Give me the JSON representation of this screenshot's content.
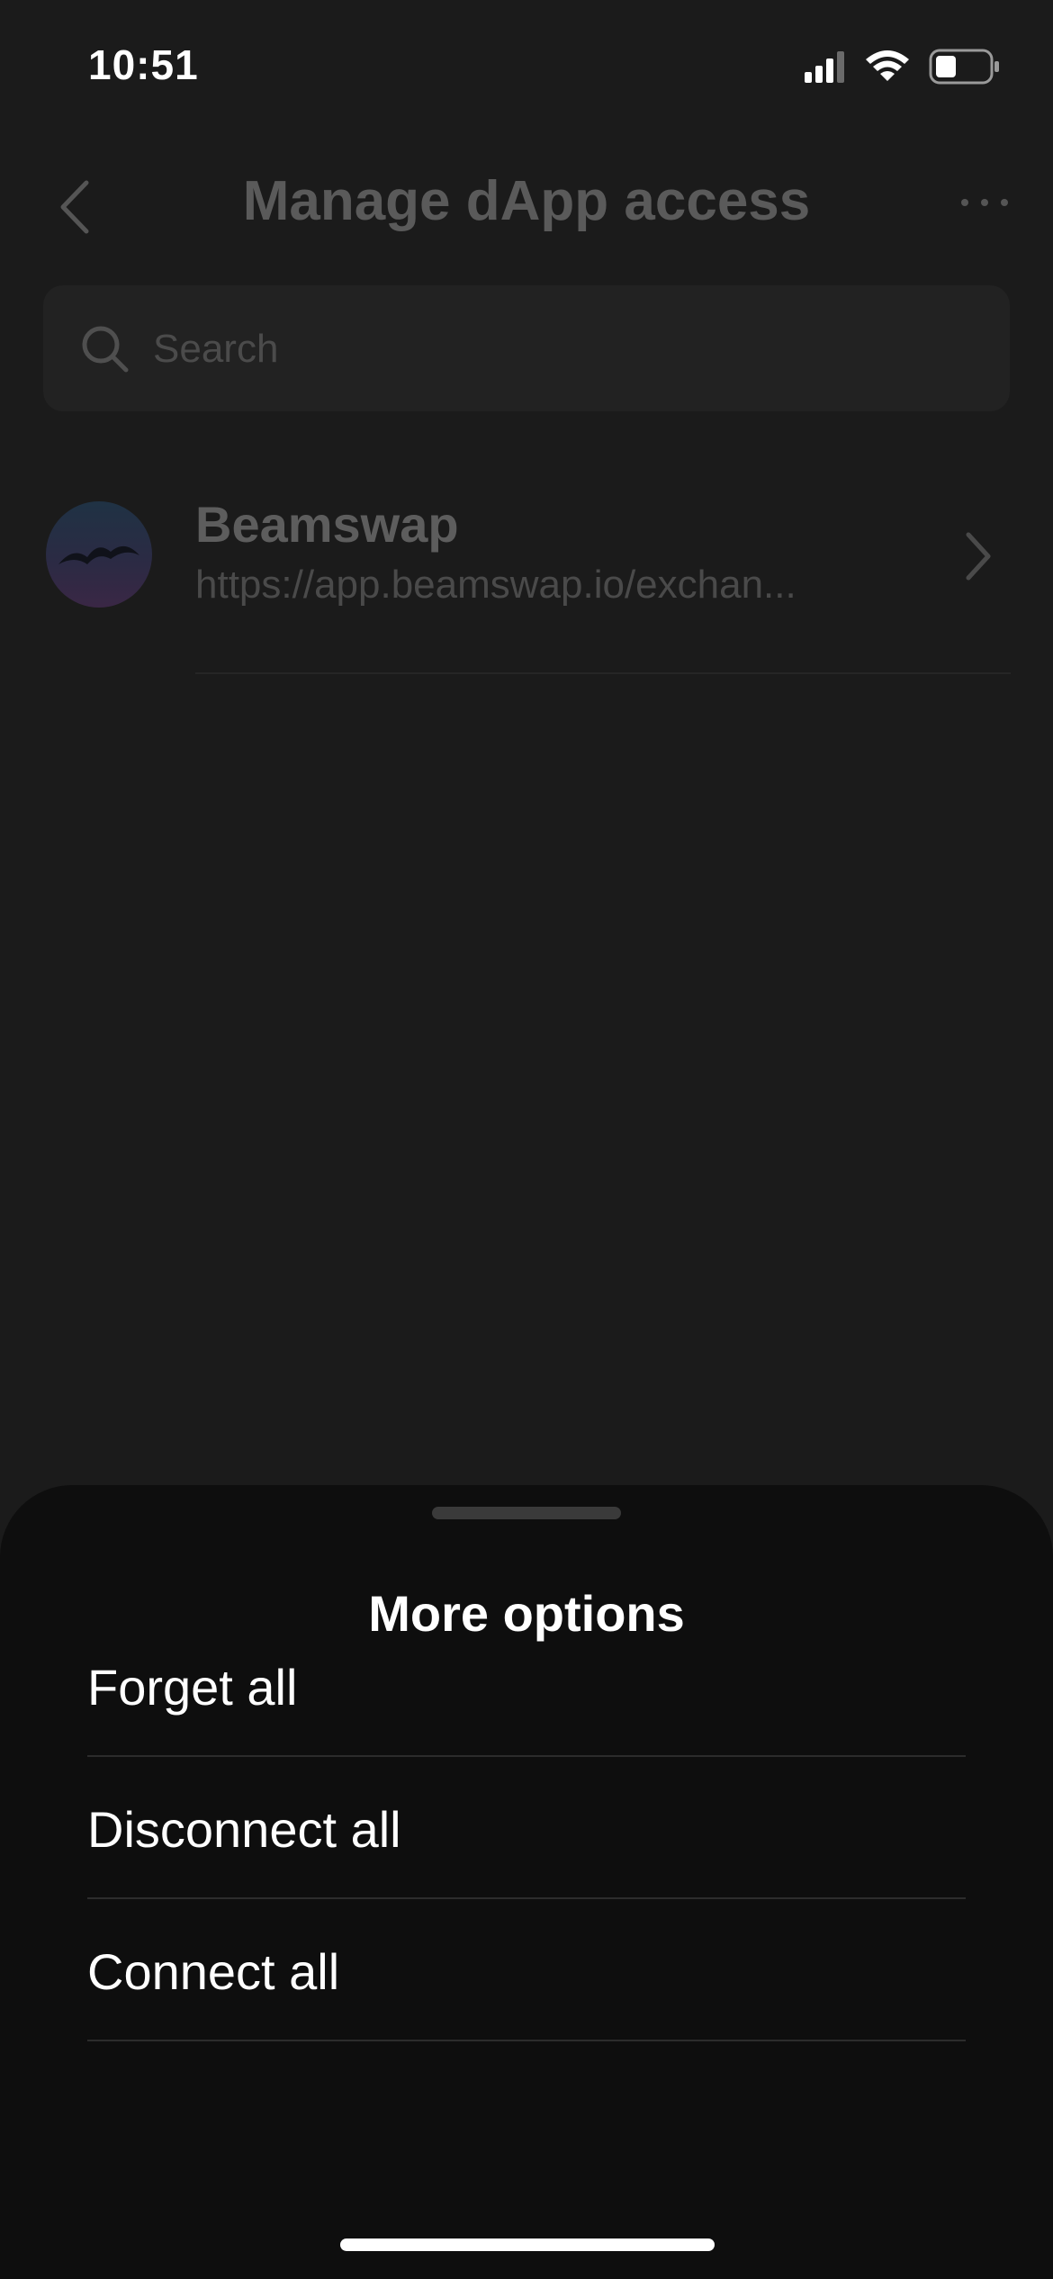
{
  "status_bar": {
    "time": "10:51",
    "icons": [
      "signal-icon",
      "wifi-icon",
      "battery-icon"
    ]
  },
  "header": {
    "title": "Manage dApp access",
    "back_icon": "chevron-left-icon",
    "more_icon": "more-horizontal-icon"
  },
  "search": {
    "placeholder": "Search"
  },
  "dapps": [
    {
      "name": "Beamswap",
      "url": "https://app.beamswap.io/exchan...",
      "icon": "beamswap-logo"
    }
  ],
  "sheet": {
    "title": "More options",
    "options": [
      {
        "label": "Forget all"
      },
      {
        "label": "Disconnect all"
      },
      {
        "label": "Connect all"
      }
    ]
  },
  "colors": {
    "background": "#1b1b1b",
    "sheet_background": "#0e0e0e",
    "text_primary": "#ffffff",
    "text_dimmed": "#5a5a5a"
  }
}
